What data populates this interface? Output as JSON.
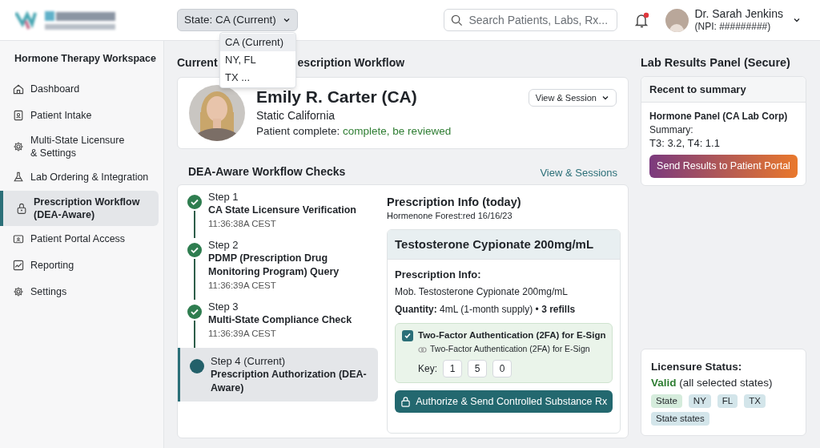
{
  "header": {
    "state_selector": {
      "label": "State: CA (Current)",
      "expanded": true,
      "options": [
        {
          "label": "CA (Current)",
          "selected": true
        },
        {
          "label": "NY, FL",
          "selected": false
        },
        {
          "label": "TX ...",
          "selected": false
        }
      ]
    },
    "search": {
      "placeholder": "Search Patients, Labs, Rx..."
    },
    "notifications": {
      "unread": true
    },
    "user": {
      "name": "Dr. Sarah Jenkins",
      "npi": "(NPI: #########)"
    }
  },
  "sidebar": {
    "title": "Hormone Therapy Workspace",
    "items": [
      {
        "label": "Dashboard",
        "selected": false
      },
      {
        "label": "Patient Intake",
        "selected": false
      },
      {
        "label": "Multi-State Licensure\n& Settings",
        "selected": false
      },
      {
        "label": "Lab Ordering & Integration",
        "selected": false
      },
      {
        "label": "Prescription Workflow\n(DEA-Aware)",
        "selected": true
      },
      {
        "label": "Patient Portal Access",
        "selected": false
      },
      {
        "label": "Reporting",
        "selected": false
      },
      {
        "label": "Settings",
        "selected": false
      }
    ]
  },
  "main": {
    "title_parts": [
      "Current",
      "escription Workflow"
    ],
    "patient": {
      "name": "Emily R. Carter (CA)",
      "location": "Static California",
      "status_label": "Patient complete:",
      "status_value": "complete, be reviewed",
      "menu": "View & Session"
    },
    "checks": {
      "title": "DEA-Aware Workflow Checks",
      "link": "View & Sessions",
      "steps": [
        {
          "kind": "done",
          "step": "Step 1",
          "title": "CA State Licensure Verification",
          "time": "11:36:38A CEST",
          "selected": false
        },
        {
          "kind": "done",
          "step": "Step 2",
          "title": "PDMP (Prescription Drug Monitoring Program) Query",
          "time": "11:36:39A CEST",
          "selected": false
        },
        {
          "kind": "done",
          "step": "Step 3",
          "title": "Multi-State Compliance Check",
          "time": "11:36:39A CEST",
          "selected": false
        },
        {
          "kind": "current",
          "step": "Step 4 (Current)",
          "title": "Prescription Authorization (DEA-Aware)",
          "selected": true
        }
      ],
      "rx": {
        "title": "Prescription Info (today)",
        "subtitle": "Hormenone Forest:red 16/16/23",
        "drug": "Testosterone Cypionate 200mg/mL",
        "info_label": "Prescription Info:",
        "info": "Mob. Testosterone Cypionate 200mg/mL",
        "quantity": "**Quantity:** 4mL (1-month supply) • **3 refills**",
        "twofa": {
          "checked": true,
          "label": "Two-Factor Authentication (2FA) for E-Sign",
          "hint": "Two-Factor Authentication (2FA) for E-Sign",
          "key_label": "Key:",
          "keys": [
            "1",
            "5",
            "0"
          ]
        },
        "button": "Authorize & Send Controlled Substance Rx"
      }
    }
  },
  "lab": {
    "title": "Lab Results Panel (Secure)",
    "card_header": "Recent to summary",
    "panel": "Hormone Panel (CA Lab Corp)",
    "summary_label": "Summary:",
    "summary": "T3: 3.2, T4: 1.1",
    "button": "Send Results to Patient Portal"
  },
  "licensure": {
    "title": "Licensure Status:",
    "status": "Valid",
    "status_note": "(all selected states)",
    "tags": [
      {
        "label": "State",
        "color": "#d5ecdc"
      },
      {
        "label": "NY",
        "color": "#d3e5ea"
      },
      {
        "label": "FL",
        "color": "#d3e5ea"
      },
      {
        "label": "TX",
        "color": "#d3e5ea"
      },
      {
        "label": "State states",
        "color": "#d3e5ea"
      }
    ]
  }
}
